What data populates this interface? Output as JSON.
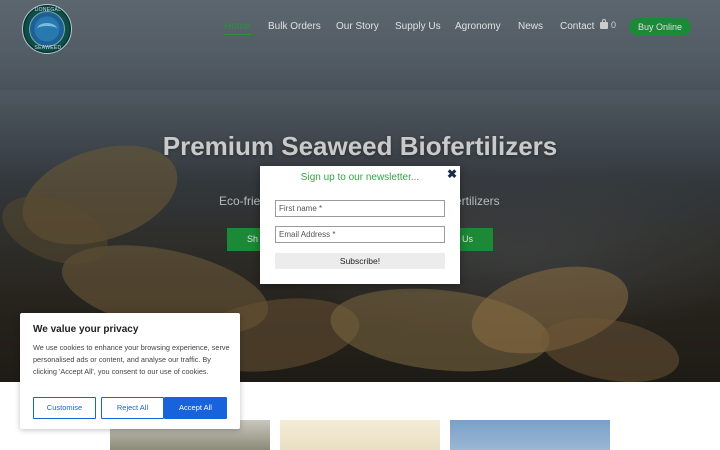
{
  "header": {
    "logo_top": "DONEGAL",
    "logo_bottom": "SEAWEED",
    "nav": [
      {
        "label": "Home"
      },
      {
        "label": "Bulk Orders"
      },
      {
        "label": "Our Story"
      },
      {
        "label": "Supply Us"
      },
      {
        "label": "Agronomy"
      },
      {
        "label": "News"
      },
      {
        "label": "Contact"
      }
    ],
    "cart_count": "0",
    "buy_label": "Buy Online"
  },
  "hero": {
    "title": "Premium Seaweed Biofertilizers",
    "subtitle_left": "Eco-frie",
    "subtitle_right": "ertilizers",
    "button_left": "Sh",
    "button_right": "Us"
  },
  "modal": {
    "title": "Sign up to our newsletter...",
    "close": "✖",
    "first_name_placeholder": "First name *",
    "email_placeholder": "Email Address *",
    "submit_label": "Subscribe!"
  },
  "cookie": {
    "title": "We value your privacy",
    "body": "We use cookies to enhance your browsing experience, serve personalised ads or content, and analyse our traffic. By clicking 'Accept All', you consent to our use of cookies.",
    "customise": "Customise",
    "reject": "Reject All",
    "accept": "Accept All"
  },
  "colors": {
    "accent_green": "#1f9d3d",
    "cookie_blue": "#1863dc"
  }
}
